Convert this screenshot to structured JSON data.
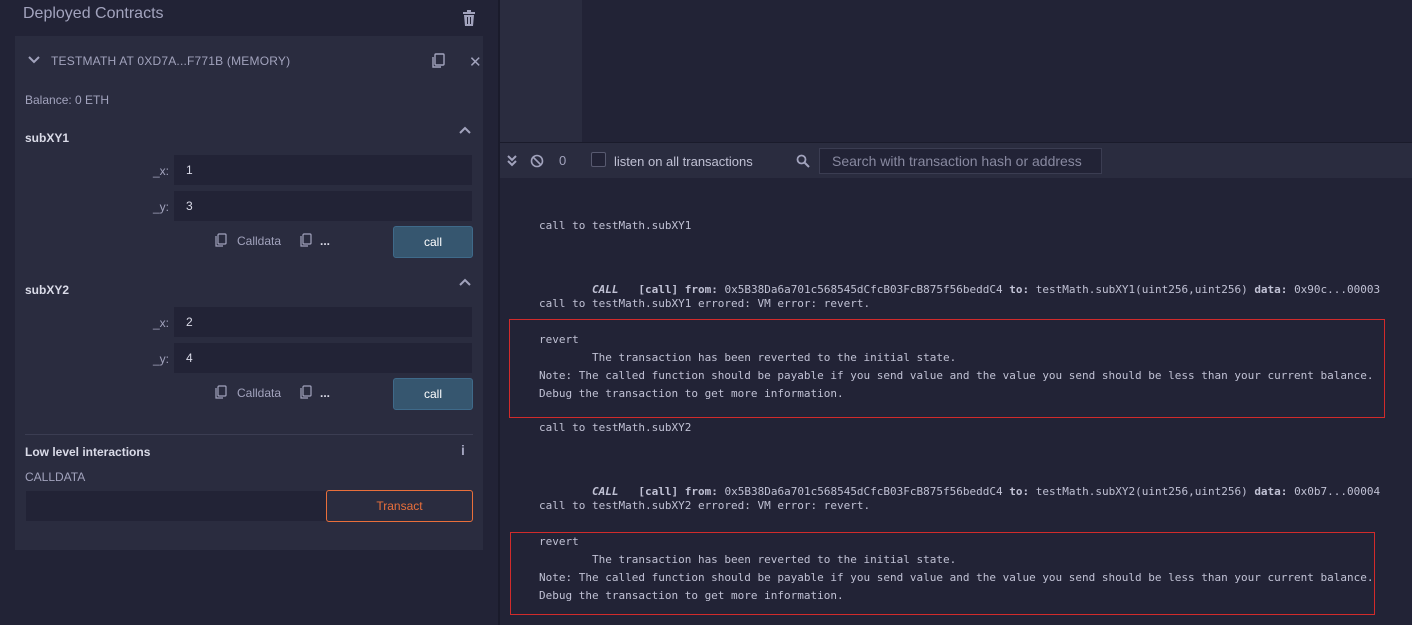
{
  "left": {
    "title": "Deployed Contracts",
    "contract": {
      "name": "TESTMATH AT 0XD7A...F771B (MEMORY)",
      "balance": "Balance: 0 ETH",
      "functions": [
        {
          "name": "subXY1",
          "params": [
            {
              "label": "_x:",
              "value": "1"
            },
            {
              "label": "_y:",
              "value": "3"
            }
          ],
          "calldata_label": "Calldata",
          "more_label": "...",
          "call_label": "call"
        },
        {
          "name": "subXY2",
          "params": [
            {
              "label": "_x:",
              "value": "2"
            },
            {
              "label": "_y:",
              "value": "4"
            }
          ],
          "calldata_label": "Calldata",
          "more_label": "...",
          "call_label": "call"
        }
      ],
      "low_level": {
        "title": "Low level interactions",
        "calldata_label": "CALLDATA",
        "calldata_value": "",
        "transact_label": "Transact"
      }
    }
  },
  "terminal": {
    "count": "0",
    "listen_label": "listen on all transactions",
    "listen_checked": false,
    "search_placeholder": "Search with transaction hash or address",
    "entries": [
      {
        "call_to": "call to testMath.subXY1",
        "tag": "CALL",
        "kind": "[call]",
        "from_label": "from:",
        "from": "0x5B38Da6a701c568545dCfcB03FcB875f56beddC4",
        "to_label": "to:",
        "to": "testMath.subXY1(uint256,uint256)",
        "data_label": "data:",
        "data": "0x90c...00003",
        "errored": "call to testMath.subXY1 errored: VM error: revert.",
        "revert_title": "revert",
        "revert_line1": "        The transaction has been reverted to the initial state.",
        "revert_line2": "Note: The called function should be payable if you send value and the value you send should be less than your current balance.",
        "revert_line3": "Debug the transaction to get more information."
      },
      {
        "call_to": "call to testMath.subXY2",
        "tag": "CALL",
        "kind": "[call]",
        "from_label": "from:",
        "from": "0x5B38Da6a701c568545dCfcB03FcB875f56beddC4",
        "to_label": "to:",
        "to": "testMath.subXY2(uint256,uint256)",
        "data_label": "data:",
        "data": "0x0b7...00004",
        "errored": "call to testMath.subXY2 errored: VM error: revert.",
        "revert_title": "revert",
        "revert_line1": "        The transaction has been reverted to the initial state.",
        "revert_line2": "Note: The called function should be payable if you send value and the value you send should be less than your current balance.",
        "revert_line3": "Debug the transaction to get more information."
      }
    ]
  },
  "colors": {
    "background": "#222336",
    "panel": "#2a2c3f",
    "call_button": "#36566f",
    "transact_accent": "#e96f3b",
    "error_border": "#d12b2b"
  }
}
